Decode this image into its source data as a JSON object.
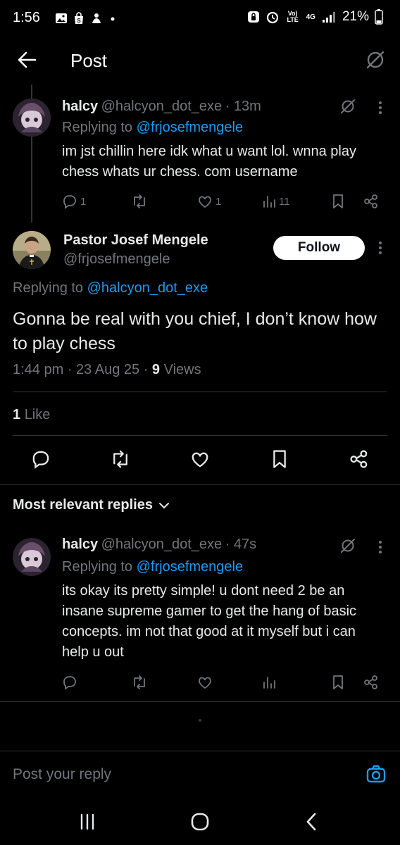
{
  "status_bar": {
    "time": "1:56",
    "battery": "21%",
    "network": "4G",
    "volte": "Vo) LTE"
  },
  "header": {
    "title": "Post"
  },
  "parent_post": {
    "name": "halcy",
    "handle": "@halcyon_dot_exe",
    "time": "· 13m",
    "replying_label": "Replying to",
    "replying_handle": "@frjosefmengele",
    "text": "im jst chillin here idk what u want lol. wnna play chess whats ur chess. com username",
    "replies": "1",
    "likes": "1",
    "views": "11"
  },
  "main_post": {
    "name": "Pastor Josef Mengele",
    "handle": "@frjosefmengele",
    "follow_label": "Follow",
    "replying_label": "Replying to",
    "replying_handle": "@halcyon_dot_exe",
    "text": "Gonna be real with you chief, I don’t know how to play chess",
    "time": "1:44 pm · 23 Aug 25 · ",
    "views_count": "9",
    "views_label": "Views",
    "likes_count": "1",
    "likes_label": "Like"
  },
  "replies_section": {
    "label": "Most relevant replies"
  },
  "reply_post": {
    "name": "halcy",
    "handle": "@halcyon_dot_exe",
    "time": "· 47s",
    "replying_label": "Replying to",
    "replying_handle": "@frjosefmengele",
    "text": "its okay its pretty simple! u dont need 2 be an insane supreme gamer to get the hang of basic concepts. im not that good at it myself but i can help u out"
  },
  "composer": {
    "placeholder": "Post your reply"
  },
  "colors": {
    "accent": "#1d9bf0",
    "muted": "#71767b",
    "background": "#000000"
  }
}
